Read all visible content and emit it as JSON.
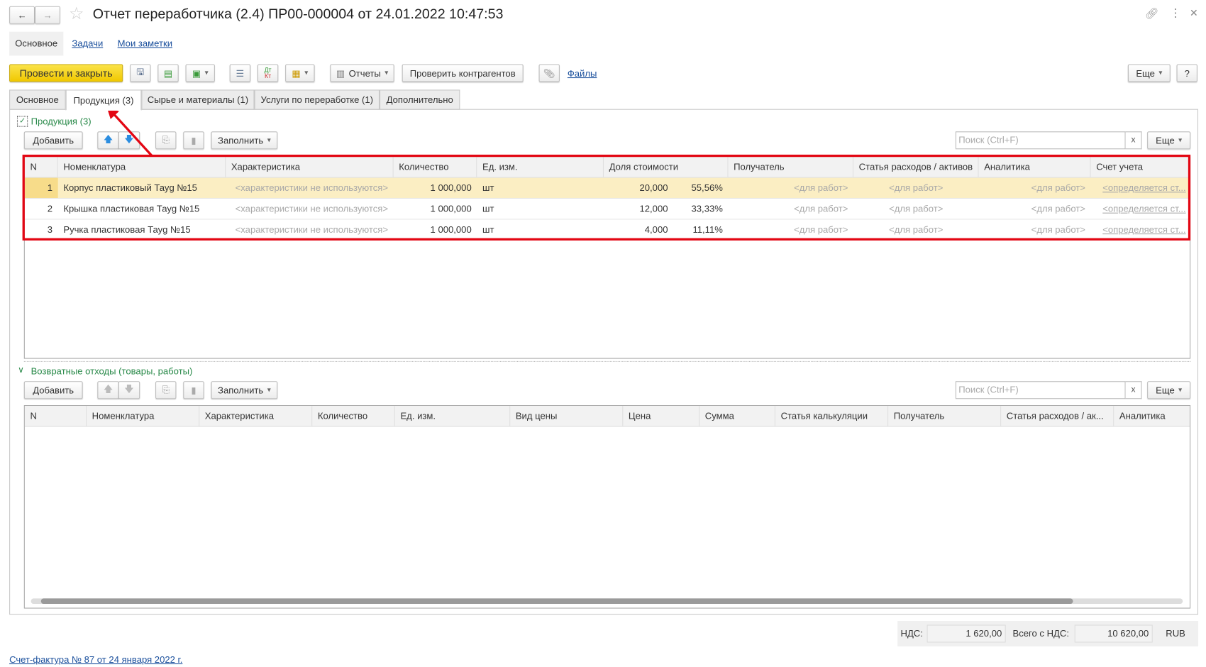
{
  "window": {
    "title": "Отчет переработчика (2.4) ПР00-000004 от 24.01.2022 10:47:53"
  },
  "nav": {
    "back": "←",
    "forward": "→"
  },
  "subnav": {
    "main": "Основное",
    "tasks": "Задачи",
    "notes": "Мои заметки"
  },
  "toolbar": {
    "post_close": "Провести и закрыть",
    "reports": "Отчеты",
    "check": "Проверить контрагентов",
    "files": "Файлы",
    "more": "Еще",
    "help": "?"
  },
  "tabs": [
    "Основное",
    "Продукция (3)",
    "Сырье и материалы (1)",
    "Услуги по переработке (1)",
    "Дополнительно"
  ],
  "products": {
    "group": "Продукция (3)",
    "add": "Добавить",
    "fill": "Заполнить",
    "search_placeholder": "Поиск (Ctrl+F)",
    "clear": "x",
    "more": "Еще",
    "columns": [
      "N",
      "Номенклатура",
      "Характеристика",
      "Количество",
      "Ед. изм.",
      "Доля стоимости",
      "Получатель",
      "Статья расходов / активов",
      "Аналитика",
      "Счет учета"
    ],
    "rows": [
      [
        "1",
        "Корпус пластиковый Тауg №15",
        "<характеристики не используются>",
        "1 000,000",
        "шт",
        "20,000",
        "55,56%",
        "<для работ>",
        "<для работ>",
        "<для работ>",
        "<определяется ст..."
      ],
      [
        "2",
        "Крышка пластиковая Тауg №15",
        "<характеристики не используются>",
        "1 000,000",
        "шт",
        "12,000",
        "33,33%",
        "<для работ>",
        "<для работ>",
        "<для работ>",
        "<определяется ст..."
      ],
      [
        "3",
        "Ручка пластиковая Тауg №15",
        "<характеристики не используются>",
        "1 000,000",
        "шт",
        "4,000",
        "11,11%",
        "<для работ>",
        "<для работ>",
        "<для работ>",
        "<определяется ст..."
      ]
    ]
  },
  "waste": {
    "group": "Возвратные отходы (товары, работы)",
    "add": "Добавить",
    "fill": "Заполнить",
    "search_placeholder": "Поиск (Ctrl+F)",
    "clear": "x",
    "more": "Еще",
    "columns": [
      "N",
      "Номенклатура",
      "Характеристика",
      "Количество",
      "Ед. изм.",
      "Вид цены",
      "Цена",
      "Сумма",
      "Статья калькуляции",
      "Получатель",
      "Статья расходов / ак...",
      "Аналитика"
    ]
  },
  "footer": {
    "vat_label": "НДС:",
    "vat": "1 620,00",
    "total_label": "Всего с НДС:",
    "total": "10 620,00",
    "currency": "RUB",
    "invoice_link": "Счет-фактура № 87 от 24 января 2022 г."
  },
  "colors": {
    "accent_yellow": "#f5d21b",
    "annotation_red": "#e30613",
    "group_green": "#2a8a4a",
    "link_blue": "#1a4f9c"
  }
}
